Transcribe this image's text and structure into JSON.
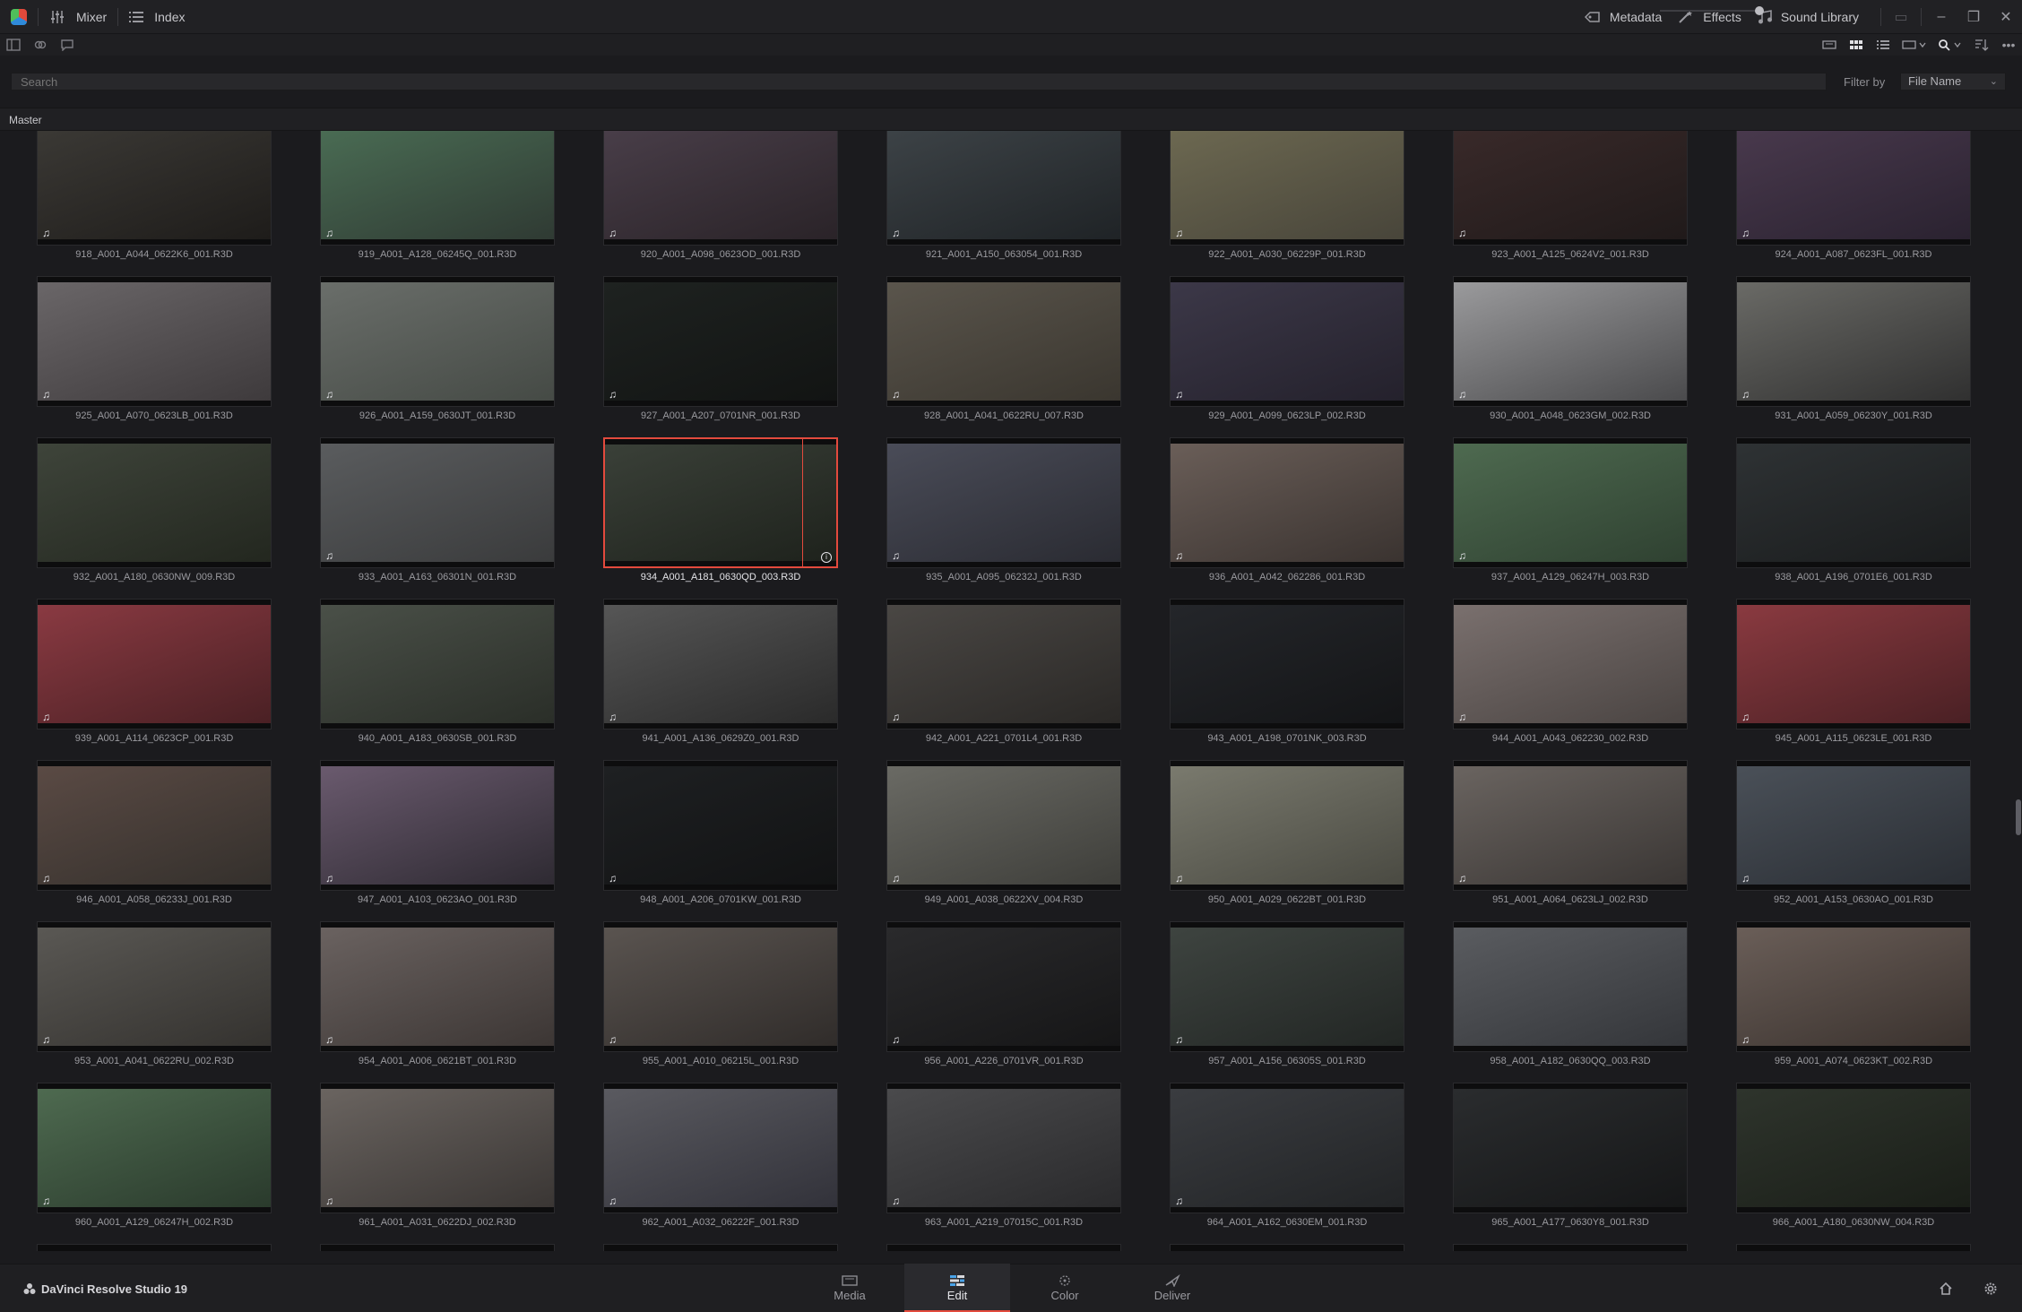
{
  "topbar": {
    "mixer_label": "Mixer",
    "index_label": "Index",
    "metadata_label": "Metadata",
    "effects_label": "Effects",
    "sound_library_label": "Sound Library"
  },
  "search": {
    "placeholder": "Search",
    "filter_label": "Filter by",
    "filter_value": "File Name"
  },
  "bin": {
    "path": "Master"
  },
  "clips": [
    {
      "name": "918_A001_A044_0622K6_001.R3D",
      "audio": true,
      "tone": "#3c3a36,#1e1c1a"
    },
    {
      "name": "919_A001_A128_06245Q_001.R3D",
      "audio": true,
      "tone": "#4b6e55,#2f3a33"
    },
    {
      "name": "920_A001_A098_0623OD_001.R3D",
      "audio": true,
      "tone": "#4a3f4a,#2a2328"
    },
    {
      "name": "921_A001_A150_063054_001.R3D",
      "audio": true,
      "tone": "#3e4448,#1f2326"
    },
    {
      "name": "922_A001_A030_06229P_001.R3D",
      "audio": true,
      "tone": "#6e6a52,#48453a"
    },
    {
      "name": "923_A001_A125_0624V2_001.R3D",
      "audio": true,
      "tone": "#3a2a2a,#201a1a"
    },
    {
      "name": "924_A001_A087_0623FL_001.R3D",
      "audio": true,
      "tone": "#4a3a4e,#2a2230"
    },
    {
      "name": "925_A001_A070_0623LB_001.R3D",
      "audio": true,
      "tone": "#6a6668,#3e3a3c"
    },
    {
      "name": "926_A001_A159_0630JT_001.R3D",
      "audio": true,
      "tone": "#6a6e6a,#454a45"
    },
    {
      "name": "927_A001_A207_0701NR_001.R3D",
      "audio": true,
      "tone": "#1e2220,#121413"
    },
    {
      "name": "928_A001_A041_0622RU_007.R3D",
      "audio": true,
      "tone": "#5a554c,#3a362f"
    },
    {
      "name": "929_A001_A099_0623LP_002.R3D",
      "audio": true,
      "tone": "#3c3848,#24212c"
    },
    {
      "name": "930_A001_A048_0623GM_002.R3D",
      "audio": true,
      "tone": "#9a9a9c,#4a4a4c"
    },
    {
      "name": "931_A001_A059_06230Y_001.R3D",
      "audio": true,
      "tone": "#6a6a66,#303030"
    },
    {
      "name": "932_A001_A180_0630NW_009.R3D",
      "audio": false,
      "tone": "#3e443a,#23271f"
    },
    {
      "name": "933_A001_A163_06301N_001.R3D",
      "audio": true,
      "tone": "#5a5c5e,#3a3b3c"
    },
    {
      "name": "934_A001_A181_0630QD_003.R3D",
      "audio": false,
      "tone": "#3a4038,#1e221c",
      "selected": true
    },
    {
      "name": "935_A001_A095_06232J_001.R3D",
      "audio": true,
      "tone": "#4a4c58,#2a2b32"
    },
    {
      "name": "936_A001_A042_062286_001.R3D",
      "audio": true,
      "tone": "#6a5e58,#3a3330"
    },
    {
      "name": "937_A001_A129_06247H_003.R3D",
      "audio": true,
      "tone": "#4e6a50,#2f4131"
    },
    {
      "name": "938_A001_A196_0701E6_001.R3D",
      "audio": false,
      "tone": "#2e3234,#1a1c1d"
    },
    {
      "name": "939_A001_A114_0623CP_001.R3D",
      "audio": true,
      "tone": "#8a3a42,#4a2024"
    },
    {
      "name": "940_A001_A183_0630SB_001.R3D",
      "audio": false,
      "tone": "#4a5048,#2a2e28"
    },
    {
      "name": "941_A001_A136_0629Z0_001.R3D",
      "audio": true,
      "tone": "#565656,#2a2a2a"
    },
    {
      "name": "942_A001_A221_0701L4_001.R3D",
      "audio": true,
      "tone": "#4a4744,#2a2826"
    },
    {
      "name": "943_A001_A198_0701NK_003.R3D",
      "audio": false,
      "tone": "#24262a,#141517"
    },
    {
      "name": "944_A001_A043_062230_002.R3D",
      "audio": true,
      "tone": "#7a706e,#4a4442"
    },
    {
      "name": "945_A001_A115_0623LE_001.R3D",
      "audio": true,
      "tone": "#8a3a40,#4a2024"
    },
    {
      "name": "946_A001_A058_06233J_001.R3D",
      "audio": true,
      "tone": "#5a4a44,#34302c"
    },
    {
      "name": "947_A001_A103_0623AO_001.R3D",
      "audio": true,
      "tone": "#6a5a6e,#2e2a32"
    },
    {
      "name": "948_A001_A206_0701KW_001.R3D",
      "audio": true,
      "tone": "#1e2022,#121314"
    },
    {
      "name": "949_A001_A038_0622XV_004.R3D",
      "audio": true,
      "tone": "#6a6a64,#3e3e3a"
    },
    {
      "name": "950_A001_A029_0622BT_001.R3D",
      "audio": true,
      "tone": "#7a7a6e,#4a4a42"
    },
    {
      "name": "951_A001_A064_0623LJ_002.R3D",
      "audio": true,
      "tone": "#6a6460,#3a3634"
    },
    {
      "name": "952_A001_A153_0630AO_001.R3D",
      "audio": true,
      "tone": "#4a5058,#2a2e34"
    },
    {
      "name": "953_A001_A041_0622RU_002.R3D",
      "audio": true,
      "tone": "#5a5854,#34322f"
    },
    {
      "name": "954_A001_A006_0621BT_001.R3D",
      "audio": true,
      "tone": "#6a6260,#3c3634"
    },
    {
      "name": "955_A001_A010_06215L_001.R3D",
      "audio": true,
      "tone": "#5a5450,#302c2a"
    },
    {
      "name": "956_A001_A226_0701VR_001.R3D",
      "audio": true,
      "tone": "#2a2a2c,#161617"
    },
    {
      "name": "957_A001_A156_06305S_001.R3D",
      "audio": true,
      "tone": "#3e4440,#222624"
    },
    {
      "name": "958_A001_A182_0630QQ_003.R3D",
      "audio": false,
      "tone": "#5a5c60,#34363a"
    },
    {
      "name": "959_A001_A074_0623KT_002.R3D",
      "audio": true,
      "tone": "#6a5e58,#3a322e"
    },
    {
      "name": "960_A001_A129_06247H_002.R3D",
      "audio": true,
      "tone": "#4e6a50,#2a3a2c"
    },
    {
      "name": "961_A001_A031_0622DJ_002.R3D",
      "audio": true,
      "tone": "#6a6460,#3a3634"
    },
    {
      "name": "962_A001_A032_06222F_001.R3D",
      "audio": true,
      "tone": "#5a5a60,#32323a"
    },
    {
      "name": "963_A001_A219_07015C_001.R3D",
      "audio": true,
      "tone": "#4a4a4c,#2a2a2c"
    },
    {
      "name": "964_A001_A162_0630EM_001.R3D",
      "audio": true,
      "tone": "#3a3c40,#222426"
    },
    {
      "name": "965_A001_A177_0630Y8_001.R3D",
      "audio": false,
      "tone": "#2a2c2e,#161718"
    },
    {
      "name": "966_A001_A180_0630NW_004.R3D",
      "audio": false,
      "tone": "#2e342c,#1a1e18"
    }
  ],
  "bottombar": {
    "brand": "DaVinci Resolve Studio 19",
    "pages": [
      {
        "label": "Media"
      },
      {
        "label": "Edit"
      },
      {
        "label": "Color"
      },
      {
        "label": "Deliver"
      }
    ]
  }
}
